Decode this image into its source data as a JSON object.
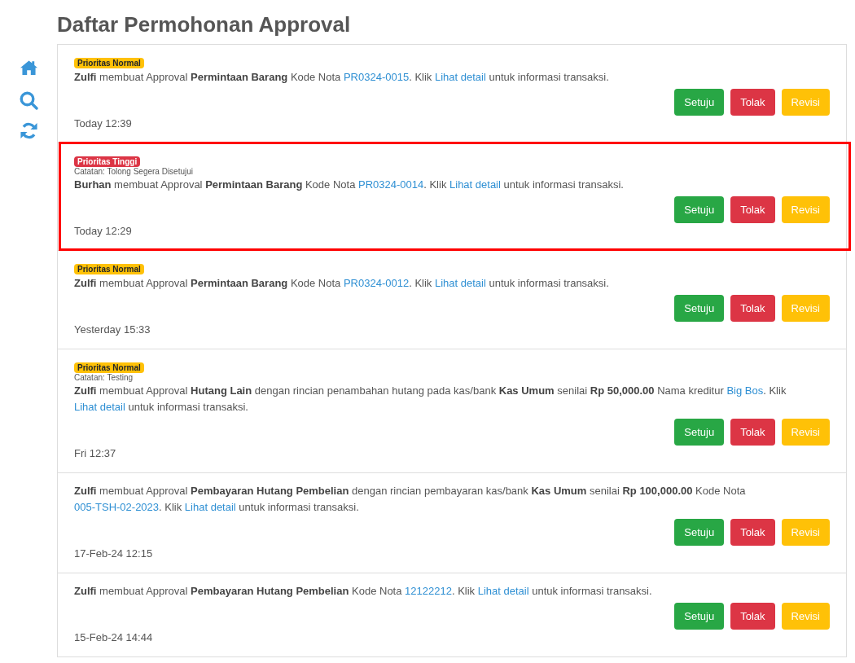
{
  "title": "Daftar Permohonan Approval",
  "items": [
    {
      "highlighted": false,
      "priority": {
        "label": "Prioritas Normal",
        "kind": "normal"
      },
      "message": [
        {
          "kind": "text",
          "text": "**Zulfi** membuat Approval **Permintaan Barang** Kode Nota "
        },
        {
          "kind": "link",
          "text": "PR0324-0015"
        },
        {
          "kind": "text",
          "text": ". Klik "
        },
        {
          "kind": "link",
          "text": "Lihat detail"
        },
        {
          "kind": "text",
          "text": " untuk informasi transaksi."
        }
      ],
      "actions": [
        {
          "label": "Setuju",
          "kind": "approve"
        },
        {
          "label": "Tolak",
          "kind": "reject"
        },
        {
          "label": "Revisi",
          "kind": "revise"
        }
      ],
      "time": "Today 12:39"
    },
    {
      "highlighted": true,
      "priority": {
        "label": "Prioritas Tinggi",
        "kind": "high"
      },
      "note": "Catatan: Tolong Segera Disetujui",
      "message": [
        {
          "kind": "text",
          "text": "**Burhan** membuat Approval **Permintaan Barang** Kode Nota "
        },
        {
          "kind": "link",
          "text": "PR0324-0014"
        },
        {
          "kind": "text",
          "text": ". Klik "
        },
        {
          "kind": "link",
          "text": "Lihat detail"
        },
        {
          "kind": "text",
          "text": " untuk informasi transaksi."
        }
      ],
      "actions": [
        {
          "label": "Setuju",
          "kind": "approve"
        },
        {
          "label": "Tolak",
          "kind": "reject"
        },
        {
          "label": "Revisi",
          "kind": "revise"
        }
      ],
      "time": "Today 12:29"
    },
    {
      "highlighted": false,
      "priority": {
        "label": "Prioritas Normal",
        "kind": "normal"
      },
      "message": [
        {
          "kind": "text",
          "text": "**Zulfi** membuat Approval **Permintaan Barang** Kode Nota "
        },
        {
          "kind": "link",
          "text": "PR0324-0012"
        },
        {
          "kind": "text",
          "text": ". Klik "
        },
        {
          "kind": "link",
          "text": "Lihat detail"
        },
        {
          "kind": "text",
          "text": " untuk informasi transaksi."
        }
      ],
      "actions": [
        {
          "label": "Setuju",
          "kind": "approve"
        },
        {
          "label": "Tolak",
          "kind": "reject"
        },
        {
          "label": "Revisi",
          "kind": "revise"
        }
      ],
      "time": "Yesterday 15:33"
    },
    {
      "highlighted": false,
      "priority": {
        "label": "Prioritas Normal",
        "kind": "normal"
      },
      "note": "Catatan: Testing",
      "message": [
        {
          "kind": "text",
          "text": "**Zulfi** membuat Approval **Hutang Lain** dengan rincian penambahan hutang pada kas/bank **Kas Umum** senilai **Rp 50,000.00** Nama kreditur "
        },
        {
          "kind": "link",
          "text": "Big Bos"
        },
        {
          "kind": "text",
          "text": ". Klik "
        },
        {
          "kind": "link",
          "text": "Lihat detail"
        },
        {
          "kind": "text",
          "text": " untuk informasi transaksi."
        }
      ],
      "actions": [
        {
          "label": "Setuju",
          "kind": "approve"
        },
        {
          "label": "Tolak",
          "kind": "reject"
        },
        {
          "label": "Revisi",
          "kind": "revise"
        }
      ],
      "time": "Fri 12:37"
    },
    {
      "highlighted": false,
      "message": [
        {
          "kind": "text",
          "text": "**Zulfi** membuat Approval **Pembayaran Hutang Pembelian** dengan rincian pembayaran kas/bank **Kas Umum** senilai **Rp 100,000.00** Kode Nota "
        },
        {
          "kind": "link",
          "text": "005-TSH-02-2023"
        },
        {
          "kind": "text",
          "text": ". Klik "
        },
        {
          "kind": "link",
          "text": "Lihat detail"
        },
        {
          "kind": "text",
          "text": " untuk informasi transaksi."
        }
      ],
      "actions": [
        {
          "label": "Setuju",
          "kind": "approve"
        },
        {
          "label": "Tolak",
          "kind": "reject"
        },
        {
          "label": "Revisi",
          "kind": "revise"
        }
      ],
      "time": "17-Feb-24 12:15"
    },
    {
      "highlighted": false,
      "message": [
        {
          "kind": "text",
          "text": "**Zulfi** membuat Approval **Pembayaran Hutang Pembelian** Kode Nota "
        },
        {
          "kind": "link",
          "text": "12122212"
        },
        {
          "kind": "text",
          "text": ". Klik "
        },
        {
          "kind": "link",
          "text": "Lihat detail"
        },
        {
          "kind": "text",
          "text": " untuk informasi transaksi."
        }
      ],
      "actions": [
        {
          "label": "Setuju",
          "kind": "approve"
        },
        {
          "label": "Tolak",
          "kind": "reject"
        },
        {
          "label": "Revisi",
          "kind": "revise"
        }
      ],
      "time": "15-Feb-24 14:44"
    }
  ]
}
